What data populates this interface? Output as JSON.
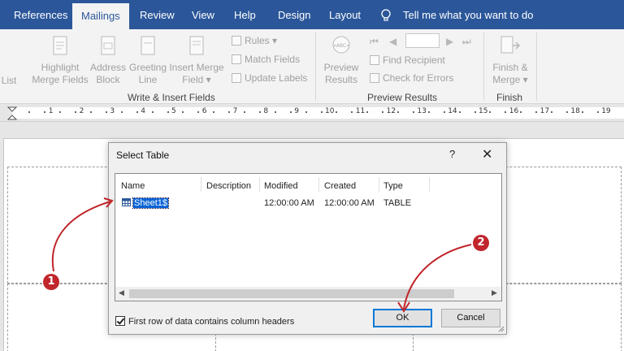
{
  "ribbon": {
    "tabs": [
      {
        "label": "References"
      },
      {
        "label": "Mailings",
        "active": true
      },
      {
        "label": "Review"
      },
      {
        "label": "View"
      },
      {
        "label": "Help"
      },
      {
        "label": "Design"
      },
      {
        "label": "Layout"
      }
    ],
    "tell_me": "Tell me what you want to do",
    "partial_list_label": "List",
    "write_insert": {
      "highlight_line1": "Highlight",
      "highlight_line2": "Merge Fields",
      "address_line1": "Address",
      "address_line2": "Block",
      "greeting_line1": "Greeting",
      "greeting_line2": "Line",
      "insert_line1": "Insert Merge",
      "insert_line2": "Field",
      "rules": "Rules",
      "match_fields": "Match Fields",
      "update_labels": "Update Labels",
      "group_label": "Write & Insert Fields"
    },
    "preview": {
      "preview_line1": "Preview",
      "preview_line2": "Results",
      "preview_icon_text": "«ABC»",
      "find_recipient": "Find Recipient",
      "check_errors": "Check for Errors",
      "group_label": "Preview Results"
    },
    "finish": {
      "finish_line1": "Finish &",
      "finish_line2": "Merge",
      "group_label": "Finish"
    }
  },
  "ruler": {
    "numbers": [
      "1",
      "2",
      "3",
      "4",
      "5",
      "6",
      "7",
      "8",
      "9",
      "10",
      "11",
      "12",
      "13",
      "14",
      "15",
      "16",
      "17",
      "18",
      "19"
    ]
  },
  "dialog": {
    "title": "Select Table",
    "help": "?",
    "close": "✕",
    "columns": [
      "Name",
      "Description",
      "Modified",
      "Created",
      "Type"
    ],
    "row": {
      "name": "Sheet1$",
      "description": "",
      "modified": "12:00:00 AM",
      "created": "12:00:00 AM",
      "type": "TABLE"
    },
    "checkbox_label": "First row of data contains column headers",
    "checkbox_checked": true,
    "ok": "OK",
    "cancel": "Cancel"
  },
  "annotations": {
    "step1": "1",
    "step2": "2",
    "color": "#c0262c"
  },
  "colors": {
    "ribbon_blue": "#2b579a",
    "selection": "#0a64d6",
    "default_button_border": "#0078d7"
  }
}
